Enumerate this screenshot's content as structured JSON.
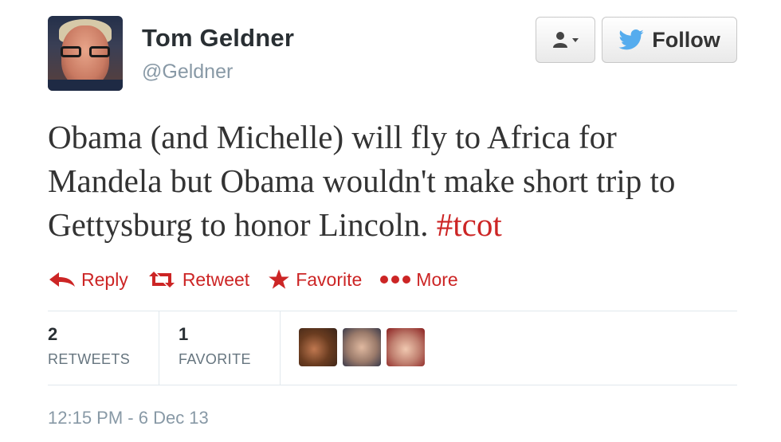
{
  "user": {
    "name": "Tom Geldner",
    "handle": "@Geldner"
  },
  "buttons": {
    "user_menu_icon": "user-dropdown-icon",
    "follow_label": "Follow"
  },
  "tweet": {
    "text_before_hashtag": "Obama (and Michelle) will fly to Africa for Mandela but Obama wouldn't make short trip to Gettysburg to honor Lincoln. ",
    "hashtag": "#tcot"
  },
  "actions": {
    "reply": "Reply",
    "retweet": "Retweet",
    "favorite": "Favorite",
    "more": "More"
  },
  "stats": {
    "retweets_count": "2",
    "retweets_label": "RETWEETS",
    "favorites_count": "1",
    "favorites_label": "FAVORITE"
  },
  "timestamp": "12:15 PM - 6 Dec 13",
  "colors": {
    "accent_red": "#cc2525",
    "twitter_blue": "#55acee",
    "muted": "#8899a6"
  }
}
